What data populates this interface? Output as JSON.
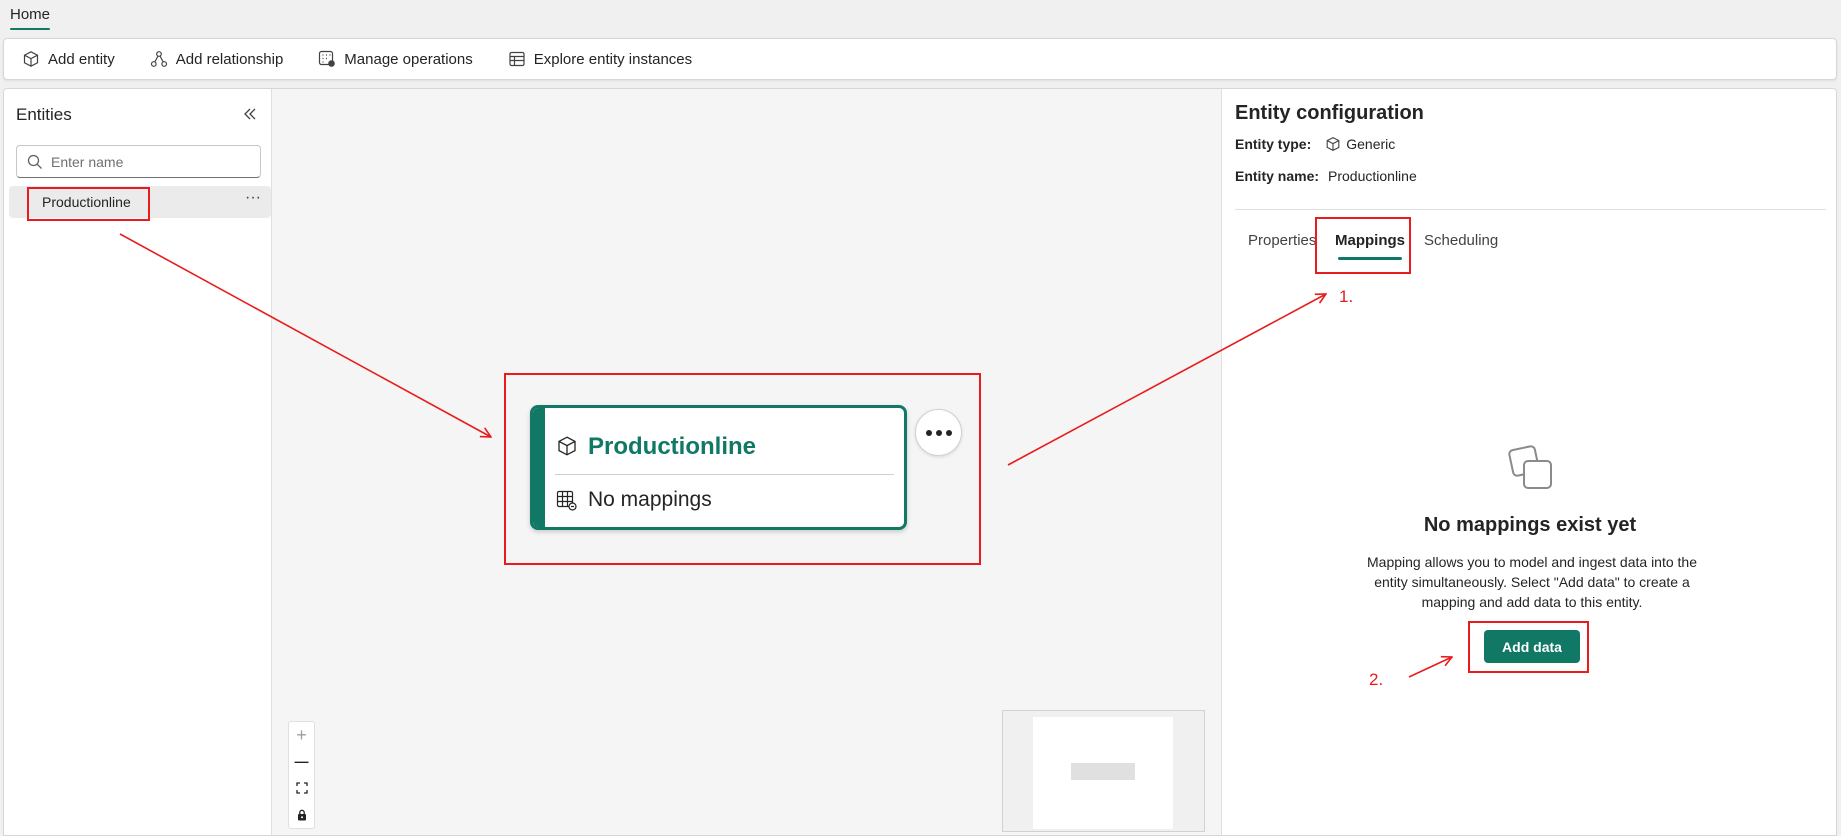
{
  "top_tabs": [
    {
      "label": "Home",
      "active": true
    }
  ],
  "ribbon": {
    "add_entity": "Add entity",
    "add_relationship": "Add relationship",
    "manage_operations": "Manage operations",
    "explore_entity_instances": "Explore entity instances"
  },
  "sidebar": {
    "title": "Entities",
    "search_placeholder": "Enter name",
    "items": [
      {
        "label": "Productionline",
        "more": "···"
      }
    ]
  },
  "canvas": {
    "node": {
      "title": "Productionline",
      "subtitle": "No mappings"
    },
    "zoom_controls": {
      "zoom_in": "+",
      "zoom_out": "—"
    }
  },
  "config_panel": {
    "title": "Entity configuration",
    "entity_type_label": "Entity type:",
    "entity_type_value": "Generic",
    "entity_name_label": "Entity name:",
    "entity_name_value": "Productionline",
    "tabs": [
      {
        "label": "Properties",
        "active": false
      },
      {
        "label": "Mappings",
        "active": true
      },
      {
        "label": "Scheduling",
        "active": false
      }
    ],
    "empty_state": {
      "title": "No mappings exist yet",
      "description": "Mapping allows you to model and ingest data into the entity simultaneously. Select \"Add data\" to create a mapping and add data to this entity.",
      "button": "Add data"
    }
  },
  "annotations": {
    "step1": "1.",
    "step2": "2."
  },
  "colors": {
    "accent": "#117865",
    "annotation": "#e81c1c"
  }
}
